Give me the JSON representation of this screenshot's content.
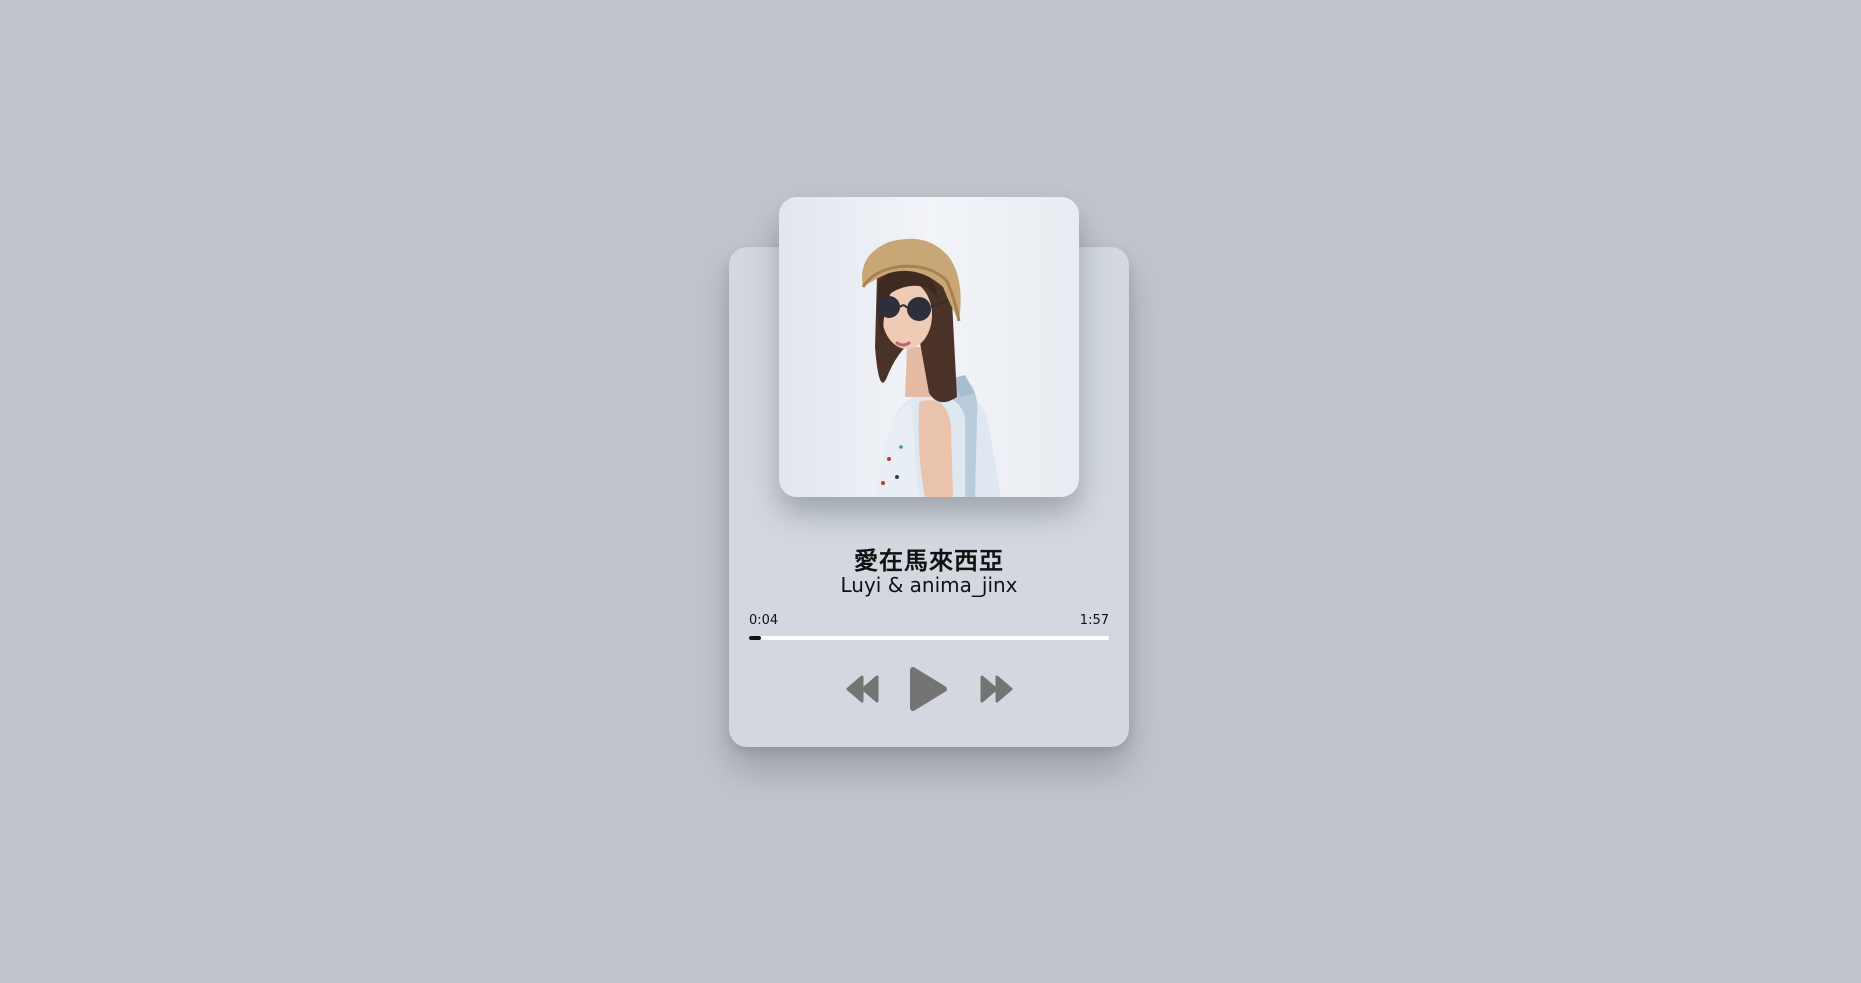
{
  "track": {
    "title": "愛在馬來西亞",
    "artist": "Luyi & anima_jinx",
    "cover_image": "album-cover-photo"
  },
  "playback": {
    "current_time": "0:04",
    "total_time": "1:57",
    "progress_fraction": 0.034
  },
  "controls": {
    "prev_icon": "rewind-icon",
    "play_icon": "play-icon",
    "next_icon": "fast-forward-icon"
  },
  "colors": {
    "background": "#c1c5cd",
    "card": "#d3d8e0",
    "text": "#111111",
    "control_icon": "#747474",
    "progress_track": "#ffffff",
    "progress_fill": "#111111"
  }
}
